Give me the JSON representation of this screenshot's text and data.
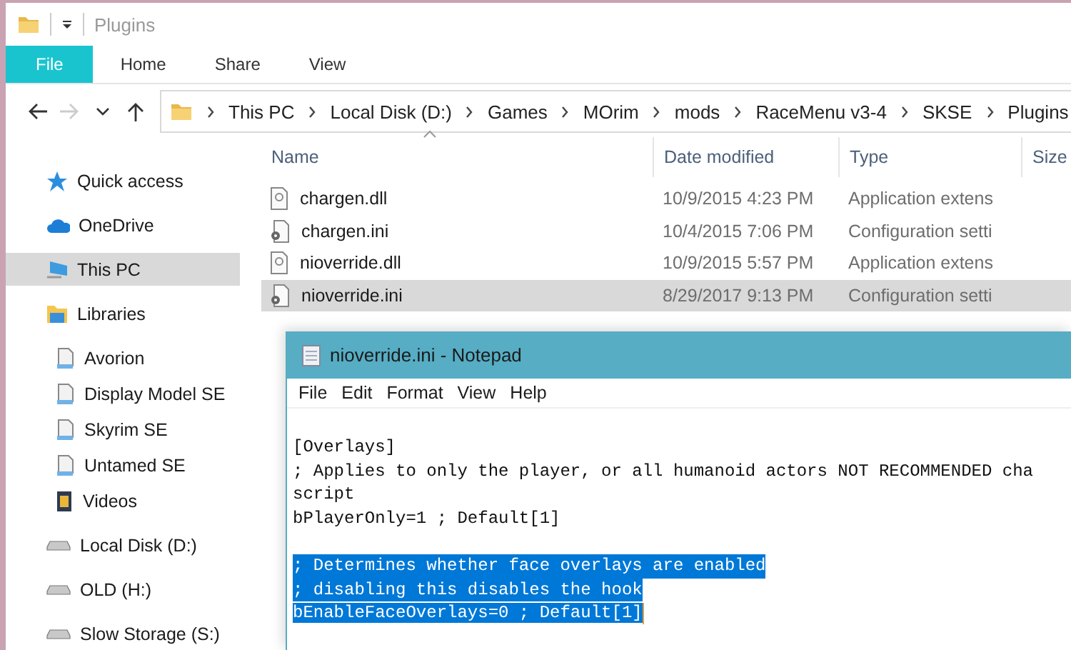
{
  "window": {
    "title": "Plugins"
  },
  "ribbon": {
    "tabs": [
      {
        "label": "File",
        "kind": "file"
      },
      {
        "label": "Home",
        "kind": "tab"
      },
      {
        "label": "Share",
        "kind": "tab"
      },
      {
        "label": "View",
        "kind": "tab"
      }
    ]
  },
  "navigation": [
    {
      "kind": "back",
      "disabled": false
    },
    {
      "kind": "forward",
      "disabled": true
    },
    {
      "kind": "recent",
      "disabled": false
    },
    {
      "kind": "up",
      "disabled": false
    }
  ],
  "address_bar": {
    "path": [
      "This PC",
      "Local Disk (D:)",
      "Games",
      "MOrim",
      "mods",
      "RaceMenu v3-4",
      "SKSE",
      "Plugins"
    ]
  },
  "sidebar": {
    "items": [
      {
        "label": "Quick access",
        "kind": "star",
        "selected": false
      },
      {
        "label": "OneDrive",
        "kind": "cloud",
        "selected": false
      },
      {
        "label": "This PC",
        "kind": "pc",
        "selected": true
      },
      {
        "label": "Libraries",
        "kind": "library",
        "selected": false,
        "children": [
          {
            "label": "Avorion",
            "kind": "library-item",
            "selected": false
          },
          {
            "label": "Display Model SE",
            "kind": "library-item",
            "selected": false
          },
          {
            "label": "Skyrim SE",
            "kind": "library-item",
            "selected": false
          },
          {
            "label": "Untamed SE",
            "kind": "library-item",
            "selected": false
          },
          {
            "label": "Videos",
            "kind": "video",
            "selected": false
          }
        ]
      },
      {
        "label": "Local Disk (D:)",
        "kind": "drive",
        "selected": false
      },
      {
        "label": "OLD (H:)",
        "kind": "drive",
        "selected": false
      },
      {
        "label": "Slow Storage (S:)",
        "kind": "drive",
        "selected": false
      }
    ]
  },
  "file_list": {
    "columns": [
      "Name",
      "Date modified",
      "Type",
      "Size"
    ],
    "rows": [
      {
        "name": "chargen.dll",
        "date_modified": "10/9/2015 4:23 PM",
        "type": "Application extens",
        "kind": "dll",
        "selected": false
      },
      {
        "name": "chargen.ini",
        "date_modified": "10/4/2015 7:06 PM",
        "type": "Configuration setti",
        "kind": "ini",
        "selected": false
      },
      {
        "name": "nioverride.dll",
        "date_modified": "10/9/2015 5:57 PM",
        "type": "Application extens",
        "kind": "dll",
        "selected": false
      },
      {
        "name": "nioverride.ini",
        "date_modified": "8/29/2017 9:13 PM",
        "type": "Configuration setti",
        "kind": "ini",
        "selected": true
      }
    ]
  },
  "notepad": {
    "title": "nioverride.ini - Notepad",
    "menu": [
      "File",
      "Edit",
      "Format",
      "View",
      "Help"
    ],
    "blocks": [
      {
        "selected": false,
        "lines": [
          "[Overlays]",
          "; Applies to only the player, or all humanoid actors NOT RECOMMENDED cha",
          "script",
          "bPlayerOnly=1 ; Default[1]"
        ]
      },
      {
        "selected": true,
        "lines": [
          "; Determines whether face overlays are enabled",
          "; disabling this disables the hook",
          "bEnableFaceOverlays=0 ; Default[1]"
        ]
      }
    ]
  }
}
